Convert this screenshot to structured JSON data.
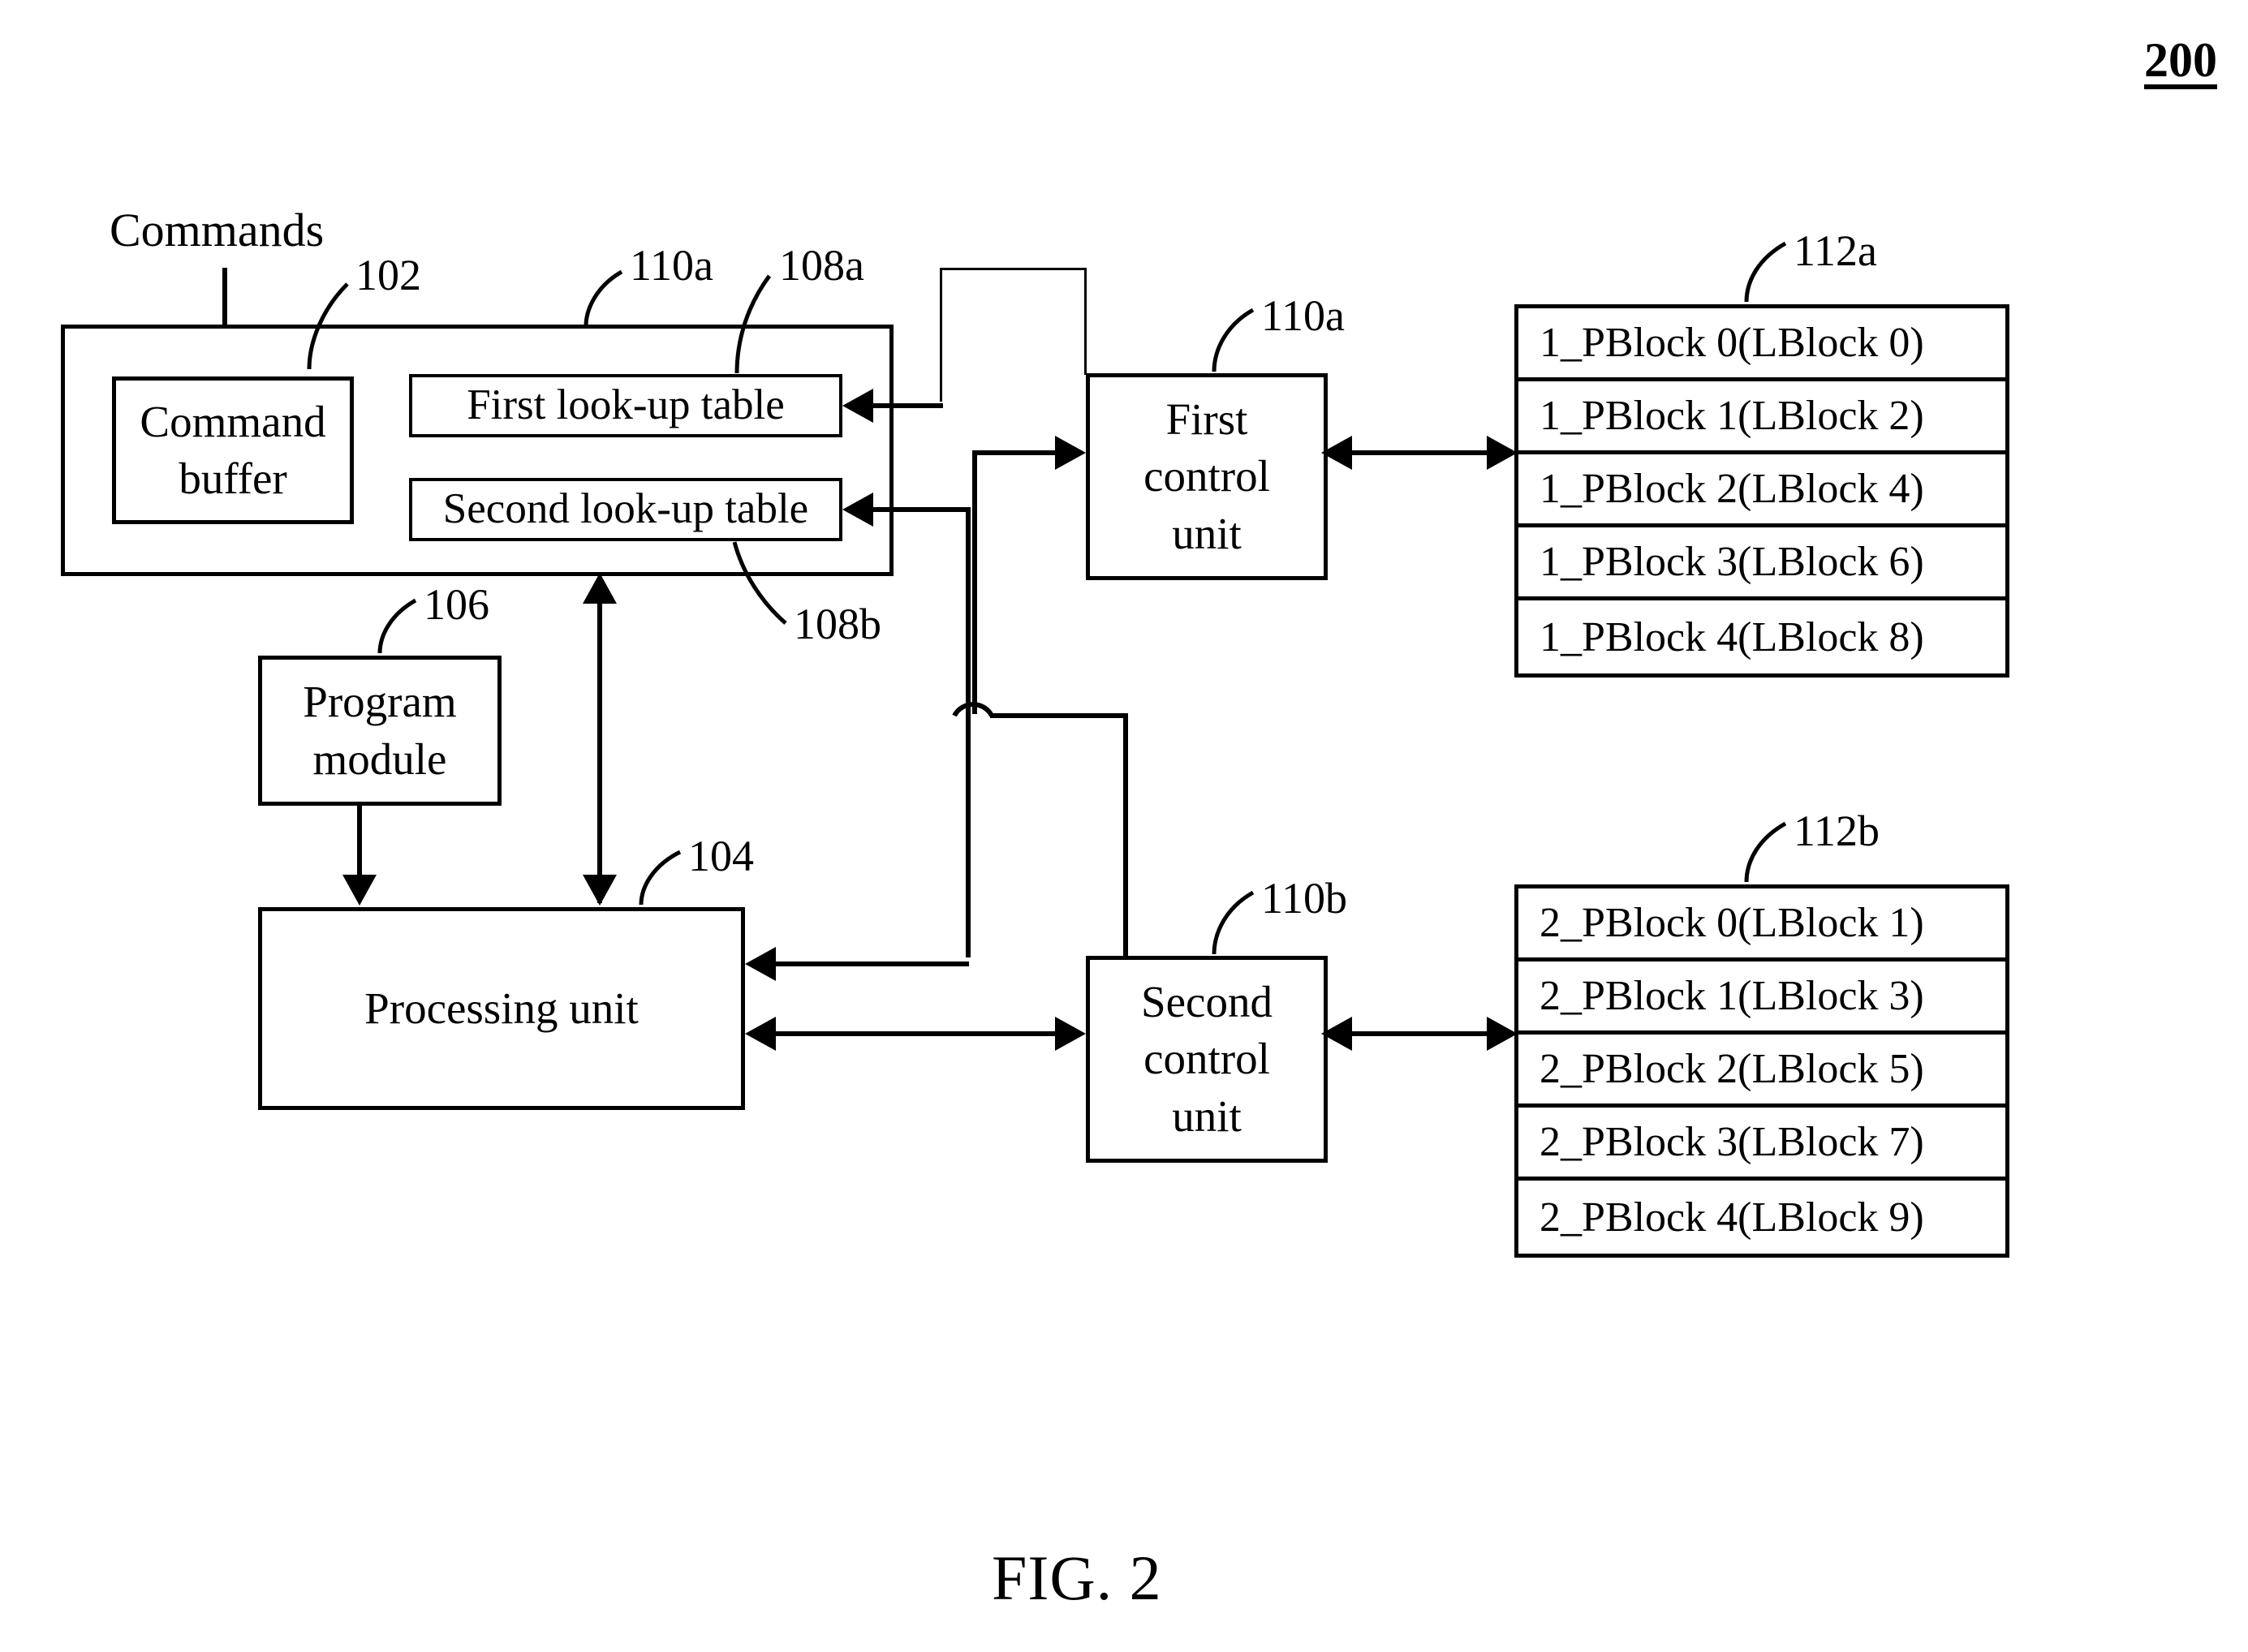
{
  "figure": {
    "doc_number": "200",
    "caption": "FIG. 2"
  },
  "labels": {
    "commands": "Commands",
    "ref_102": "102",
    "ref_104": "104",
    "ref_106": "106",
    "ref_108a": "108a",
    "ref_108b": "108b",
    "ref_110a_top": "110a",
    "ref_110a_unit": "110a",
    "ref_110b": "110b",
    "ref_112a": "112a",
    "ref_112b": "112b"
  },
  "blocks": {
    "command_buffer": "Command\nbuffer",
    "command_buffer_line1": "Command",
    "command_buffer_line2": "buffer",
    "first_lookup_table": "First look-up table",
    "second_lookup_table": "Second look-up table",
    "program_module_line1": "Program",
    "program_module_line2": "module",
    "processing_unit": "Processing unit",
    "first_control_unit_line1": "First",
    "first_control_unit_line2": "control",
    "first_control_unit_line3": "unit",
    "second_control_unit_line1": "Second",
    "second_control_unit_line2": "control",
    "second_control_unit_line3": "unit"
  },
  "block_tables": {
    "first": {
      "ref": "112a",
      "rows": [
        "1_PBlock 0(LBlock 0)",
        "1_PBlock 1(LBlock 2)",
        "1_PBlock 2(LBlock 4)",
        "1_PBlock 3(LBlock 6)",
        "1_PBlock 4(LBlock 8)"
      ]
    },
    "second": {
      "ref": "112b",
      "rows": [
        "2_PBlock 0(LBlock 1)",
        "2_PBlock 1(LBlock 3)",
        "2_PBlock 2(LBlock 5)",
        "2_PBlock 3(LBlock 7)",
        "2_PBlock 4(LBlock 9)"
      ]
    }
  },
  "colors": {
    "stroke": "#000000",
    "background": "#ffffff"
  }
}
